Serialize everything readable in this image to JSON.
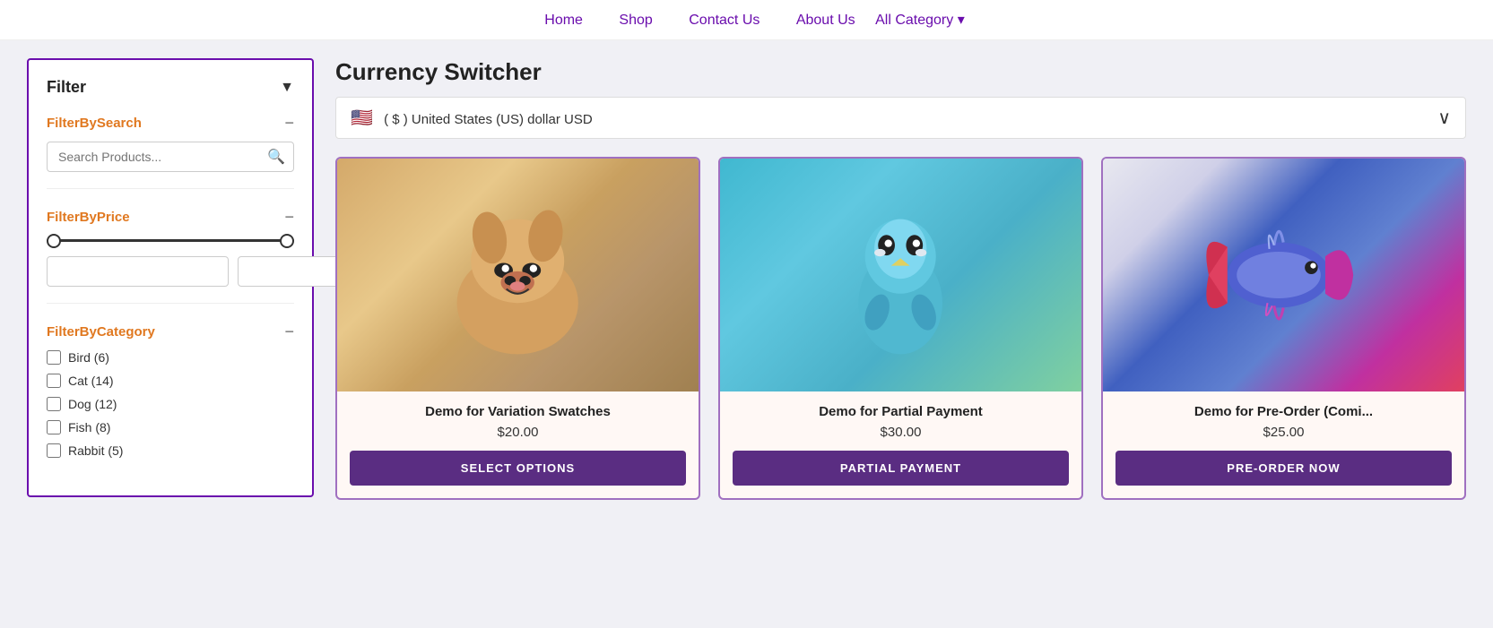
{
  "nav": {
    "links": [
      {
        "id": "home",
        "label": "Home"
      },
      {
        "id": "shop",
        "label": "Shop"
      },
      {
        "id": "contact",
        "label": "Contact Us"
      },
      {
        "id": "about",
        "label": "About Us"
      },
      {
        "id": "all-category",
        "label": "All Category ▾"
      }
    ]
  },
  "sidebar": {
    "filter_label": "Filter",
    "sections": {
      "search": {
        "label": "FilterBySearch",
        "placeholder": "Search Products...",
        "collapse": "−"
      },
      "price": {
        "label": "FilterByPrice",
        "collapse": "−",
        "min": "0",
        "max": "249"
      },
      "category": {
        "label": "FilterByCategory",
        "collapse": "−",
        "items": [
          {
            "name": "Bird (6)",
            "checked": false
          },
          {
            "name": "Cat (14)",
            "checked": false
          },
          {
            "name": "Dog (12)",
            "checked": false
          },
          {
            "name": "Fish (8)",
            "checked": false
          },
          {
            "name": "Rabbit (5)",
            "checked": false
          }
        ]
      }
    }
  },
  "content": {
    "currency_switcher": {
      "title": "Currency Switcher",
      "selected": "( $ ) United States (US) dollar USD",
      "flag_emoji": "🇺🇸"
    },
    "products": [
      {
        "id": "product-1",
        "name": "Demo for Variation Swatches",
        "price": "$20.00",
        "btn_label": "SELECT OPTIONS",
        "animal": "dog"
      },
      {
        "id": "product-2",
        "name": "Demo for Partial Payment",
        "price": "$30.00",
        "btn_label": "PARTIAL PAYMENT",
        "animal": "bird"
      },
      {
        "id": "product-3",
        "name": "Demo for Pre-Order (Comi...",
        "price": "$25.00",
        "btn_label": "PRE-ORDER NOW",
        "animal": "fish"
      }
    ]
  }
}
